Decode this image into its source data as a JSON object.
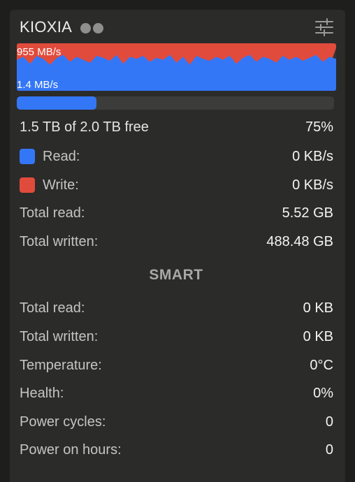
{
  "header": {
    "title": "KIOXIA",
    "settings_icon": "sliders-icon"
  },
  "chart": {
    "read_label": "955 MB/s",
    "write_label": "1.4 MB/s",
    "colors": {
      "read": "#e14b3c",
      "write": "#3477f6"
    }
  },
  "chart_data": {
    "type": "area",
    "series": [
      {
        "name": "Read",
        "values": [
          0.99,
          0.98,
          0.97,
          0.99,
          0.96,
          0.98,
          0.99,
          0.95,
          0.98,
          0.99,
          0.97,
          0.99,
          0.96,
          0.98,
          0.99,
          0.97,
          0.99,
          0.98,
          0.96,
          0.99,
          0.97,
          0.98,
          0.99,
          0.97,
          0.96,
          0.99,
          0.98,
          0.99,
          0.97,
          0.98,
          0.99,
          0.96,
          0.99,
          0.98,
          0.97,
          0.99,
          0.98,
          0.99,
          0.97,
          0.98,
          0.96,
          0.99,
          0.98,
          0.97,
          0.99,
          0.98,
          0.99,
          0.97,
          0.2
        ]
      },
      {
        "name": "Write",
        "values": [
          0.3,
          0.45,
          0.1,
          0.5,
          0.35,
          0.05,
          0.4,
          0.55,
          0.2,
          0.45,
          0.3,
          0.15,
          0.5,
          0.4,
          0.25,
          0.55,
          0.1,
          0.45,
          0.35,
          0.5,
          0.2,
          0.4,
          0.3,
          0.55,
          0.15,
          0.45,
          0.05,
          0.5,
          0.35,
          0.25,
          0.45,
          0.3,
          0.5,
          0.1,
          0.4,
          0.55,
          0.2,
          0.45,
          0.35,
          0.15,
          0.5,
          0.3,
          0.45,
          0.25,
          0.4,
          0.55,
          0.2,
          0.45,
          0.35
        ]
      }
    ]
  },
  "disk": {
    "free_text": "1.5 TB of 2.0 TB free",
    "percent": "75%",
    "usage_fraction": 0.25
  },
  "stats": {
    "read_label": "Read:",
    "read_value": "0 KB/s",
    "write_label": "Write:",
    "write_value": "0 KB/s",
    "total_read_label": "Total read:",
    "total_read_value": "5.52 GB",
    "total_written_label": "Total written:",
    "total_written_value": "488.48 GB"
  },
  "smart": {
    "title": "SMART",
    "total_read_label": "Total read:",
    "total_read_value": "0 KB",
    "total_written_label": "Total written:",
    "total_written_value": "0 KB",
    "temperature_label": "Temperature:",
    "temperature_value": "0°C",
    "health_label": "Health:",
    "health_value": "0%",
    "power_cycles_label": "Power cycles:",
    "power_cycles_value": "0",
    "power_on_hours_label": "Power on hours:",
    "power_on_hours_value": "0"
  }
}
